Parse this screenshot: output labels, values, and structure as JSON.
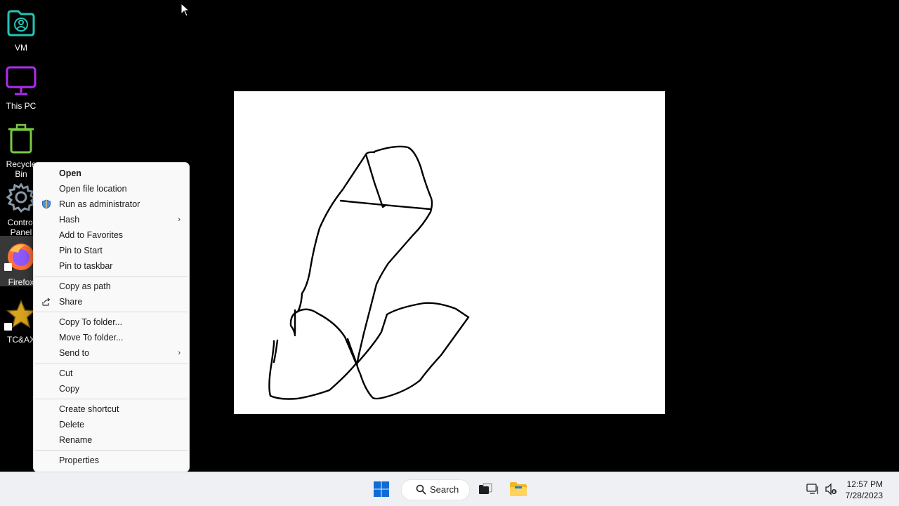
{
  "desktop": {
    "icons": [
      {
        "label": "VM",
        "icon": "vm-folder-icon"
      },
      {
        "label": "This PC",
        "icon": "monitor-icon"
      },
      {
        "label": "Recycle\nBin",
        "icon": "recycle-bin-icon"
      },
      {
        "label": "Control\nPanel",
        "icon": "gear-icon"
      },
      {
        "label": "Firefox",
        "icon": "firefox-icon"
      },
      {
        "label": "TC&AX",
        "icon": "star-icon"
      }
    ]
  },
  "context_menu": {
    "items": [
      {
        "label": "Open"
      },
      {
        "label": "Open file location"
      },
      {
        "label": "Run as administrator",
        "icon": "shield-icon"
      },
      {
        "label": "Hash",
        "submenu": true
      },
      {
        "label": "Add to Favorites"
      },
      {
        "label": "Pin to Start"
      },
      {
        "label": "Pin to taskbar"
      },
      {
        "label": "Copy as path"
      },
      {
        "label": "Share",
        "icon": "share-icon"
      },
      {
        "label": "Copy To folder..."
      },
      {
        "label": "Move To folder..."
      },
      {
        "label": "Send to",
        "submenu": true
      },
      {
        "label": "Cut"
      },
      {
        "label": "Copy"
      },
      {
        "label": "Create shortcut"
      },
      {
        "label": "Delete"
      },
      {
        "label": "Rename"
      },
      {
        "label": "Properties"
      }
    ]
  },
  "taskbar": {
    "search_label": "Search",
    "time": "12:57 PM",
    "date": "7/28/2023",
    "icons": [
      "windows-start-icon",
      "search-icon",
      "task-view-icon",
      "file-explorer-icon",
      "network-icon",
      "volume-muted-icon"
    ]
  },
  "colors": {
    "taskbar_bg": "#eef0f3",
    "menu_bg": "#f9f9f9",
    "vm_icon": "#22c4b4",
    "thispc_icon": "#b02cf0",
    "recycle_icon": "#7ac943",
    "control_panel_icon": "#8a9aa8",
    "star_icon": "#d9a520",
    "start_blue": "#0f6cd6"
  }
}
